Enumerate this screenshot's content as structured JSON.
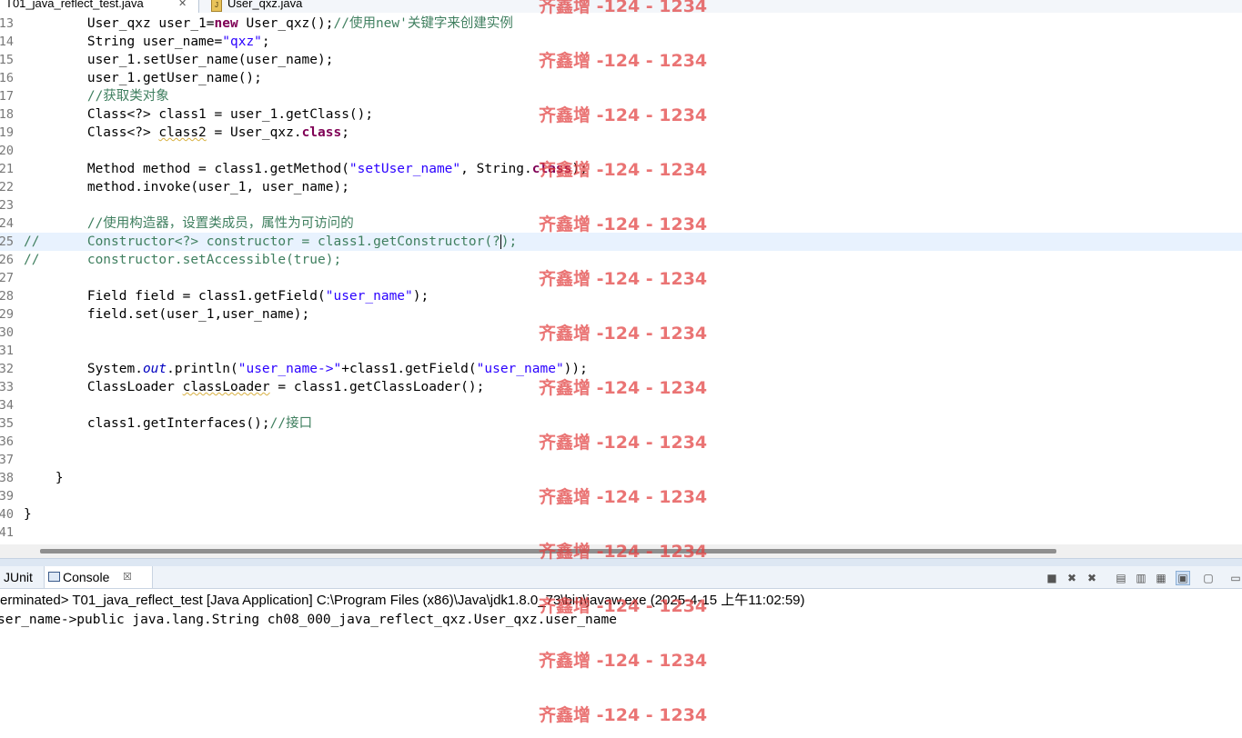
{
  "tabs": {
    "active_label": "T01_java_reflect_test.java",
    "other_label": "User_qxz.java"
  },
  "editor": {
    "lines": [
      {
        "num": "13",
        "segs": [
          {
            "t": "        User_qxz user_1="
          },
          {
            "t": "new",
            "c": "kw"
          },
          {
            "t": " User_qxz();"
          },
          {
            "t": "//使用new'关键字来创建实例",
            "c": "cm"
          }
        ]
      },
      {
        "num": "14",
        "segs": [
          {
            "t": "        String user_name="
          },
          {
            "t": "\"qxz\"",
            "c": "str"
          },
          {
            "t": ";"
          }
        ]
      },
      {
        "num": "15",
        "segs": [
          {
            "t": "        user_1.setUser_name(user_name);"
          }
        ]
      },
      {
        "num": "16",
        "segs": [
          {
            "t": "        user_1.getUser_name();"
          }
        ]
      },
      {
        "num": "17",
        "segs": [
          {
            "t": "        //获取类对象",
            "c": "cm"
          }
        ]
      },
      {
        "num": "18",
        "segs": [
          {
            "t": "        Class<?> class1 = user_1.getClass();"
          }
        ]
      },
      {
        "num": "19",
        "segs": [
          {
            "t": "        Class<?> "
          },
          {
            "t": "class2",
            "c": "squig"
          },
          {
            "t": " = User_qxz."
          },
          {
            "t": "class",
            "c": "kw"
          },
          {
            "t": ";"
          }
        ]
      },
      {
        "num": "20",
        "segs": []
      },
      {
        "num": "21",
        "segs": [
          {
            "t": "        Method method = class1.getMethod("
          },
          {
            "t": "\"setUser_name\"",
            "c": "str"
          },
          {
            "t": ", String."
          },
          {
            "t": "class",
            "c": "kw"
          },
          {
            "t": ");"
          }
        ]
      },
      {
        "num": "22",
        "segs": [
          {
            "t": "        method.invoke(user_1, user_name);"
          }
        ]
      },
      {
        "num": "23",
        "segs": []
      },
      {
        "num": "24",
        "segs": [
          {
            "t": "        //使用构造器，设置类成员，属性为可访问的",
            "c": "cm"
          }
        ]
      },
      {
        "num": "25",
        "hl": true,
        "segs": [
          {
            "t": "//      Constructor<?> constructor = class1.getConstructor(?",
            "c": "cm"
          },
          {
            "caret": true
          },
          {
            "t": ");",
            "c": "cm"
          }
        ]
      },
      {
        "num": "26",
        "segs": [
          {
            "t": "//      constructor.setAccessible(true);",
            "c": "cm"
          }
        ]
      },
      {
        "num": "27",
        "segs": []
      },
      {
        "num": "28",
        "segs": [
          {
            "t": "        Field field = class1.getField("
          },
          {
            "t": "\"user_name\"",
            "c": "str"
          },
          {
            "t": ");"
          }
        ]
      },
      {
        "num": "29",
        "segs": [
          {
            "t": "        field.set(user_1,user_name);"
          }
        ]
      },
      {
        "num": "30",
        "segs": []
      },
      {
        "num": "31",
        "segs": []
      },
      {
        "num": "32",
        "segs": [
          {
            "t": "        System."
          },
          {
            "t": "out",
            "c": "sf"
          },
          {
            "t": ".println("
          },
          {
            "t": "\"user_name->\"",
            "c": "str"
          },
          {
            "t": "+class1.getField("
          },
          {
            "t": "\"user_name\"",
            "c": "str"
          },
          {
            "t": "));"
          }
        ]
      },
      {
        "num": "33",
        "segs": [
          {
            "t": "        ClassLoader "
          },
          {
            "t": "classLoader",
            "c": "squig"
          },
          {
            "t": " = class1.getClassLoader();"
          }
        ]
      },
      {
        "num": "34",
        "segs": []
      },
      {
        "num": "35",
        "segs": [
          {
            "t": "        class1.getInterfaces();"
          },
          {
            "t": "//接口",
            "c": "cm"
          }
        ]
      },
      {
        "num": "36",
        "segs": []
      },
      {
        "num": "37",
        "segs": []
      },
      {
        "num": "38",
        "segs": [
          {
            "t": "    }"
          }
        ]
      },
      {
        "num": "39",
        "segs": []
      },
      {
        "num": "40",
        "segs": [
          {
            "t": "}"
          }
        ]
      },
      {
        "num": "41",
        "segs": []
      }
    ]
  },
  "console": {
    "junit_label": "JUnit",
    "console_label": "Console",
    "close_glyph": "☒",
    "status_text": "erminated> T01_java_reflect_test [Java Application] C:\\Program Files (x86)\\Java\\jdk1.8.0_73\\bin\\javaw.exe (2025-4-15 上午11:02:59)",
    "output_line": "ser_name->public java.lang.String ch08_000_java_reflect_qxz.User_qxz.user_name",
    "tools": [
      "terminate-icon",
      "remove-launch-icon",
      "remove-all-icon",
      "clear-console-icon",
      "scroll-lock-icon",
      "word-wrap-icon",
      "show-on-stdout-icon",
      "show-on-stderr-icon",
      "pin-console-icon",
      "display-console-icon"
    ]
  },
  "watermark": {
    "text": "齐鑫增 -124 - 1234",
    "color": "#e24040"
  }
}
